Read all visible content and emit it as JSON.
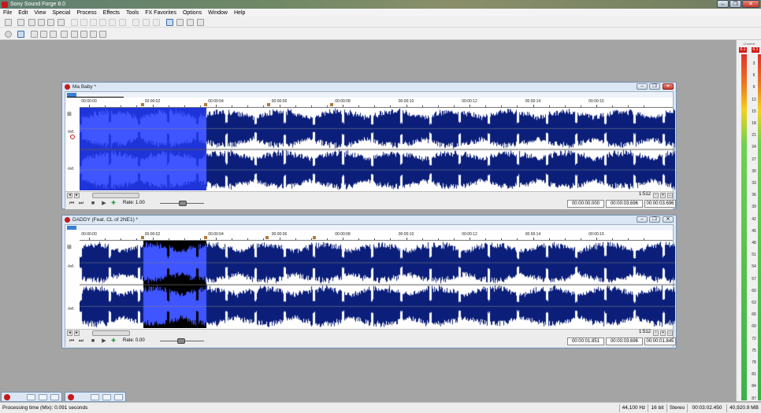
{
  "app": {
    "title": "Sony Sound Forge 8.0"
  },
  "menu": [
    "File",
    "Edit",
    "View",
    "Special",
    "Process",
    "Effects",
    "Tools",
    "FX Favorites",
    "Options",
    "Window",
    "Help"
  ],
  "window_controls": {
    "minimize": "–",
    "restore": "❐",
    "close": "✕"
  },
  "meter": {
    "header": "Channel",
    "peak_left": "6.1",
    "peak_right": "6.1",
    "scale": [
      "3",
      "6",
      "9",
      "12",
      "15",
      "18",
      "21",
      "24",
      "27",
      "30",
      "33",
      "36",
      "39",
      "42",
      "45",
      "48",
      "51",
      "54",
      "57",
      "60",
      "63",
      "66",
      "69",
      "72",
      "75",
      "78",
      "81",
      "84",
      "87"
    ]
  },
  "documents": [
    {
      "title": "Ma Baby *",
      "ruler": [
        "00:00:00",
        "00:00:02",
        "00:00:04",
        "00:00:06",
        "00:00:08",
        "00:00:10",
        "00:00:12",
        "00:00:14",
        "00:00:16"
      ],
      "channel_labels": [
        "-Inf.",
        "-Inf."
      ],
      "zoom_ratio": "1:512",
      "rate_label": "Rate: 1.00",
      "selection_start": "00:00:00.000",
      "selection_end": "00:00:03.696",
      "selection_length": "00:00:03.696",
      "markers": [
        "1",
        "2"
      ]
    },
    {
      "title": "DADDY (Feat. CL of 2NE1) *",
      "ruler": [
        "00:00:00",
        "00:00:02",
        "00:00:04",
        "00:00:06",
        "00:00:08",
        "00:00:10",
        "00:00:12",
        "00:00:14",
        "00:00:16"
      ],
      "channel_labels": [
        "-Inf.",
        "-Inf."
      ],
      "zoom_ratio": "1:512",
      "rate_label": "Rate: 0.00",
      "selection_start": "00:00:01.851",
      "selection_end": "00:00:03.696",
      "selection_length": "00:00:01.845",
      "markers": [
        "01",
        "02",
        "03"
      ]
    }
  ],
  "status_bar": {
    "processing": "Processing time (Mix): 0.091 seconds",
    "sample_rate": "44,100 Hz",
    "bit_depth": "16 bit",
    "channels": "Stereo",
    "length": "00:03:02.450",
    "disk_space": "40,920.9 MB"
  },
  "colors": {
    "waveform": "#0b1f7a",
    "selection_bg": "#1f34d8",
    "selection_dark_bg": "#000000",
    "selection_wave": "#3f55ff"
  }
}
